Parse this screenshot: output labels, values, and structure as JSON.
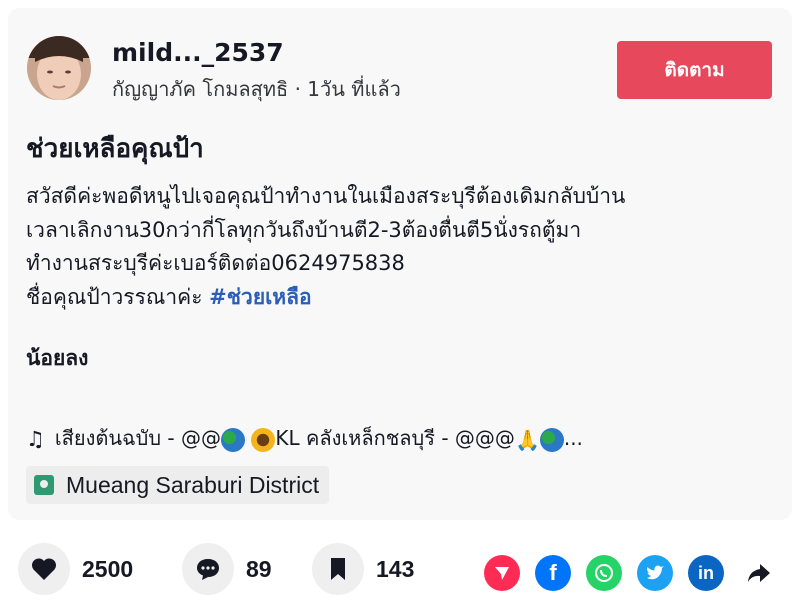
{
  "post": {
    "username": "mild..._2537",
    "subline": "กัญญาภัค โกมลสุทธิ · 1วัน ที่แล้ว",
    "follow_label": "ติดตาม",
    "title": "ช่วยเหลือคุณป้า",
    "description_lines": [
      "สวัสดีค่ะพอดีหนูไปเจอคุณป้าทำงานในเมืองสระบุรีต้องเดิมกลับบ้าน",
      "เวลาเลิกงาน30กว่ากี่โลทุกวันถึงบ้านตี2-3ต้องตื่นตี5นั่งรถตู้มา",
      "ทำงานสระบุรีค่ะเบอร์ติดต่อ0624975838",
      "ชื่อคุณป้าวรรณาค่ะ"
    ],
    "hashtag": "#ช่วยเหลือ",
    "less_label": "น้อยลง",
    "music_note": "♫",
    "music_part1": "เสียงต้นฉบับ - @@",
    "music_part2": "KL คลังเหล็กชลบุรี - @@@",
    "music_ellipsis": "...",
    "location": "Mueang Saraburi District"
  },
  "actions": {
    "likes": "2500",
    "comments": "89",
    "saves": "143"
  },
  "share": {
    "icons": [
      "send-icon",
      "facebook-icon",
      "whatsapp-icon",
      "twitter-icon",
      "linkedin-icon",
      "forward-icon"
    ],
    "colors": {
      "send": "#fe2c55",
      "facebook": "#0075fa",
      "whatsapp": "#25d366",
      "twitter": "#1da1f2",
      "linkedin": "#0a66c2"
    }
  },
  "colors": {
    "follow_button": "#e8485c",
    "hashtag": "#2b5db9",
    "location_icon": "#2d9a72"
  }
}
